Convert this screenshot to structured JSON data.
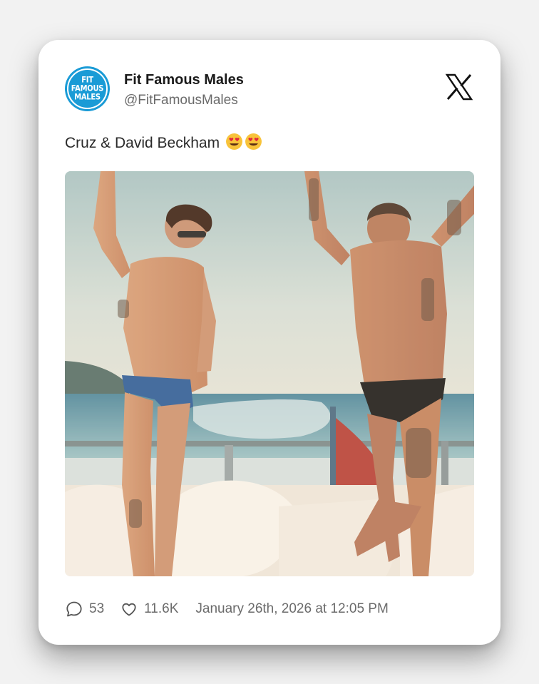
{
  "author": {
    "display_name": "Fit Famous Males",
    "handle": "@FitFamousMales",
    "avatar_text": [
      "FIT",
      "FAMOUS",
      "MALES"
    ],
    "avatar_color": "#1a9bd6"
  },
  "platform": {
    "logo_icon": "x-logo-icon"
  },
  "tweet": {
    "text": "Cruz & David Beckham",
    "emojis": [
      "heart-eyes-emoji",
      "heart-eyes-emoji"
    ]
  },
  "media": {
    "icon": "photo-image"
  },
  "stats": {
    "replies_icon": "comment-icon",
    "replies": "53",
    "likes_icon": "heart-icon",
    "likes": "11.6K",
    "timestamp": "January 26th, 2026 at 12:05 PM"
  }
}
